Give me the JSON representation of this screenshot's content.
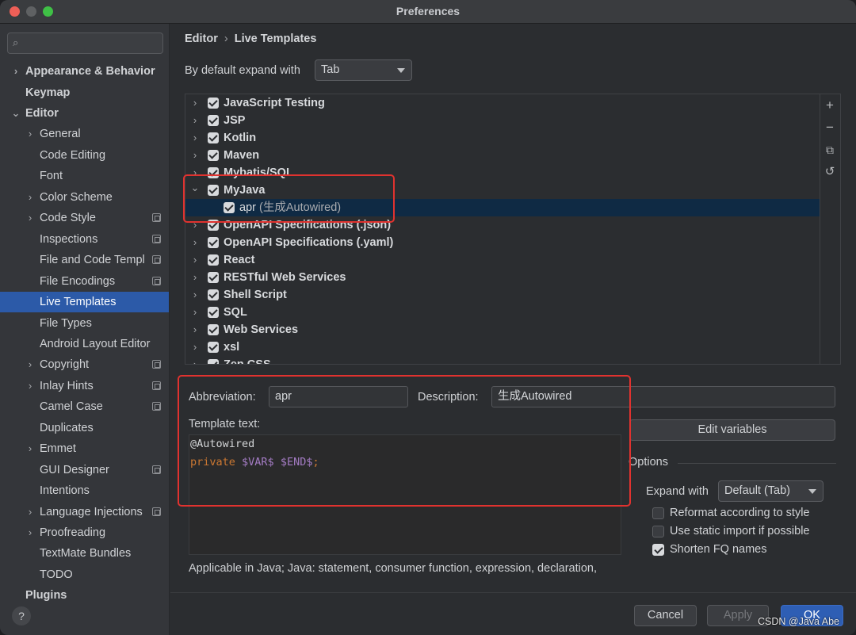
{
  "window": {
    "title": "Preferences"
  },
  "search": {
    "placeholder": ""
  },
  "sidebar": {
    "items": [
      {
        "label": "Appearance & Behavior",
        "chevron": "›"
      },
      {
        "label": "Keymap"
      },
      {
        "label": "Editor",
        "chevron": "⌄"
      },
      {
        "label": "General",
        "chevron": "›"
      },
      {
        "label": "Code Editing"
      },
      {
        "label": "Font"
      },
      {
        "label": "Color Scheme",
        "chevron": "›"
      },
      {
        "label": "Code Style",
        "chevron": "›"
      },
      {
        "label": "Inspections"
      },
      {
        "label": "File and Code Templ"
      },
      {
        "label": "File Encodings"
      },
      {
        "label": "Live Templates"
      },
      {
        "label": "File Types"
      },
      {
        "label": "Android Layout Editor"
      },
      {
        "label": "Copyright",
        "chevron": "›"
      },
      {
        "label": "Inlay Hints",
        "chevron": "›"
      },
      {
        "label": "Camel Case"
      },
      {
        "label": "Duplicates"
      },
      {
        "label": "Emmet",
        "chevron": "›"
      },
      {
        "label": "GUI Designer"
      },
      {
        "label": "Intentions"
      },
      {
        "label": "Language Injections",
        "chevron": "›"
      },
      {
        "label": "Proofreading",
        "chevron": "›"
      },
      {
        "label": "TextMate Bundles"
      },
      {
        "label": "TODO"
      },
      {
        "label": "Plugins"
      }
    ],
    "help": "?"
  },
  "breadcrumb": {
    "parent": "Editor",
    "sep": "›",
    "current": "Live Templates"
  },
  "expand": {
    "label": "By default expand with",
    "value": "Tab"
  },
  "tree": {
    "chevron_closed": "›",
    "chevron_open": "⌄",
    "rows": [
      {
        "label": "JavaScript Testing"
      },
      {
        "label": "JSP"
      },
      {
        "label": "Kotlin"
      },
      {
        "label": "Maven"
      },
      {
        "label": "Mybatis/SQL"
      },
      {
        "label": "MyJava"
      },
      {
        "label": "apr",
        "desc": "(生成Autowired)"
      },
      {
        "label": "OpenAPI Specifications (.json)"
      },
      {
        "label": "OpenAPI Specifications (.yaml)"
      },
      {
        "label": "React"
      },
      {
        "label": "RESTful Web Services"
      },
      {
        "label": "Shell Script"
      },
      {
        "label": "SQL"
      },
      {
        "label": "Web Services"
      },
      {
        "label": "xsl"
      },
      {
        "label": "Zen CSS"
      }
    ]
  },
  "toolbar": {
    "add": "+",
    "remove": "−",
    "copy": "⧉",
    "restore": "↺"
  },
  "editor": {
    "abbreviation_label": "Abbreviation:",
    "abbreviation": "apr",
    "description_label": "Description:",
    "description": "生成Autowired",
    "template_text_label": "Template text:",
    "line1": "@Autowired",
    "kw": "private",
    "var1": "$VAR$",
    "var2": "$END$",
    "semi": ";",
    "edit_variables": "Edit variables"
  },
  "options": {
    "title": "Options",
    "expand_label": "Expand with",
    "expand_value": "Default (Tab)",
    "reformat": "Reformat according to style",
    "static_import": "Use static import if possible",
    "shorten_fq": "Shorten FQ names"
  },
  "applicable": "Applicable in Java; Java: statement, consumer function, expression, declaration,",
  "footer": {
    "cancel": "Cancel",
    "apply": "Apply",
    "ok": "OK"
  },
  "watermark": "CSDN @Java Abe"
}
